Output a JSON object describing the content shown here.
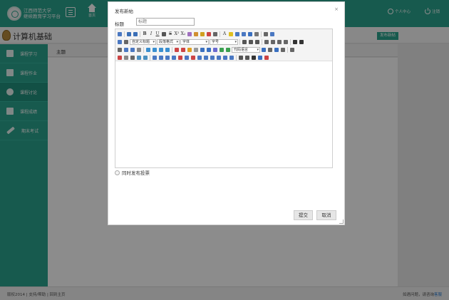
{
  "header": {
    "logo_line1": "江西师范大学",
    "logo_line2": "继续教育学习平台",
    "home_label": "首页",
    "personal_center": "个人中心",
    "logout": "注销"
  },
  "course": {
    "title": "计算机基础",
    "new_post_button": "发布新帖"
  },
  "sidebar": {
    "items": [
      {
        "label": "课程学习",
        "icon": "book-icon"
      },
      {
        "label": "课程作业",
        "icon": "document-icon"
      },
      {
        "label": "课程讨论",
        "icon": "chat-icon",
        "active": true
      },
      {
        "label": "课程成绩",
        "icon": "grade-icon"
      },
      {
        "label": "期末考试",
        "icon": "pencil-icon"
      }
    ]
  },
  "content": {
    "column_header": "主题"
  },
  "footer": {
    "left": "版权2014 | 支持/帮助 | 回到主页",
    "right_prefix": "如遇问题，请咨询",
    "right_link": "客服"
  },
  "dialog": {
    "title": "发布新帖",
    "close": "×",
    "title_label": "标题",
    "title_placeholder": "标题",
    "toolbar": {
      "heading_select": "自定义标题",
      "paragraph_select": "段落格式",
      "font_family_select": "字体",
      "font_size_select": "字号",
      "code_language_select": "代码语言"
    },
    "vote_label": "同时发布投票",
    "submit": "提交",
    "cancel": "取消"
  },
  "colors": {
    "accent": "#2aa58e",
    "overlay": "rgba(0,0,0,0.45)"
  }
}
